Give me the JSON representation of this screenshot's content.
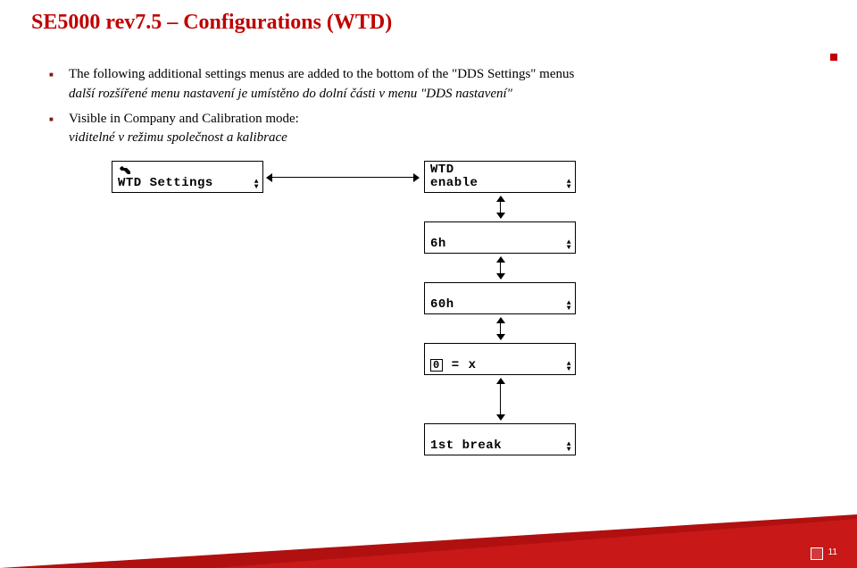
{
  "title": "SE5000 rev7.5 – Configurations (WTD)",
  "bullets": {
    "b1": {
      "line1": "The following additional settings menus are added to the bottom of the \"DDS Settings\" menus",
      "line2": "další rozšířené menu nastavení je umístěno do dolní části v menu \"DDS nastavení\""
    },
    "b2": {
      "line1": "Visible in Company and Calibration mode:",
      "line2": "viditelné v režimu společnost a kalibrace"
    }
  },
  "lcd": {
    "settings": {
      "line2": "WTD Settings"
    },
    "enable": {
      "line1": "WTD",
      "line2": "enable"
    },
    "six": {
      "line2": "6h"
    },
    "sixty": {
      "line2": "60h"
    },
    "formula": {
      "line2_chars": [
        "0",
        "=",
        "x"
      ]
    },
    "break": {
      "line2": "1st break"
    }
  },
  "page_number": "11"
}
